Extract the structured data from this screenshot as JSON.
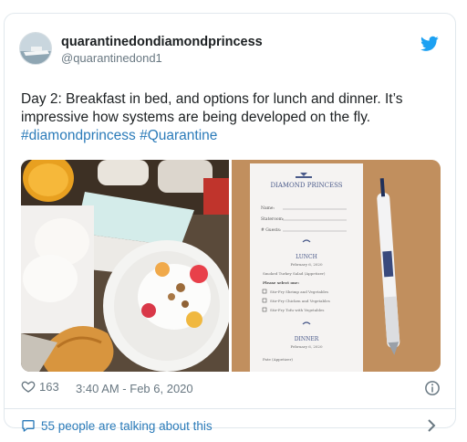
{
  "tweet": {
    "display_name": "quarantinedondiamondprincess",
    "handle": "@quarantinedond1",
    "text": "Day 2: Breakfast in bed, and options for lunch and dinner. It’s impressive how systems are being developed on the fly.",
    "hashtags": "#diamondprincess #Quarantine",
    "likes": "163",
    "timestamp": "3:40 AM - Feb 6, 2020",
    "talking": "55 people are talking about this"
  },
  "menu_card": {
    "brand": "DIAMOND PRINCESS",
    "fields": [
      "Name:",
      "Stateroom:",
      "# Guests:"
    ],
    "lunch_title": "LUNCH",
    "lunch_date": "February 6, 2020",
    "lunch_starter": "Smoked Turkey Salad (Appetizer)",
    "select_label": "Please select one:",
    "lunch_options": [
      "Stir-Fry Shrimp and Vegetables",
      "Stir-Fry Chicken and Vegetables",
      "Stir-Fry Tofu with Vegetables"
    ],
    "dinner_title": "DINNER",
    "dinner_date": "February 6, 2020",
    "dinner_starter": "Pate (Appetizer)"
  },
  "colors": {
    "link": "#2b7bb9",
    "meta": "#697882",
    "twitter_blue": "#1da1f2"
  },
  "icons": {
    "brand": "twitter-bird-icon",
    "like": "heart-icon",
    "info": "info-icon",
    "talk": "speech-bubble-icon",
    "more": "chevron-right-icon"
  }
}
